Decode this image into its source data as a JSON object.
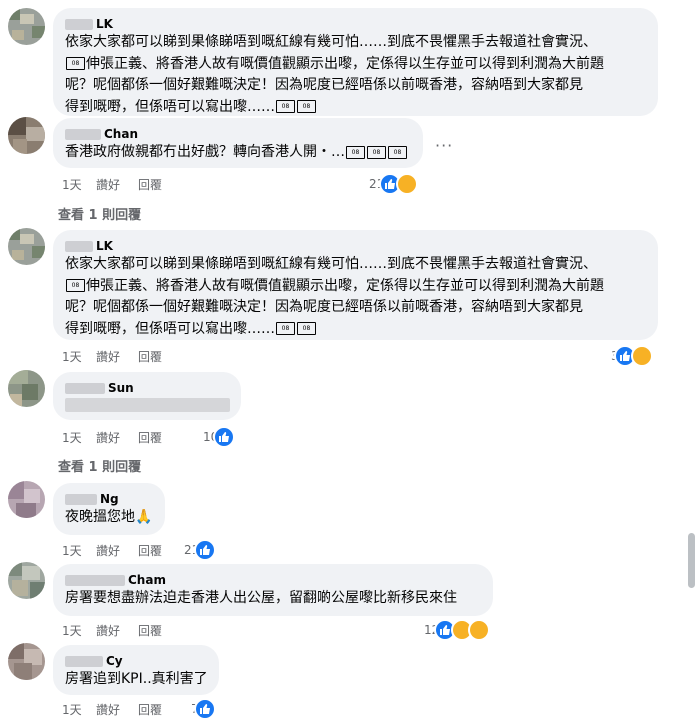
{
  "comments": [
    {
      "name": "LK",
      "text_lines": [
        "依家大家都可以睇到果條睇唔到嘅紅線有幾可怕……到底不畏懼黑手去報道社會實況、",
        "伸張正義、將香港人故有嘅價值觀顯示出嚟，定係得以生存並可以得到利潤為大前題",
        "呢？呢個都係一個好艱難嘅決定！因為呢度已經唔係以前嘅香港，容納唔到大家都見",
        "得到嘅嘢，但係唔可以寫出嚟……"
      ],
      "time": "",
      "like": "",
      "reply": "",
      "count": ""
    },
    {
      "name": "Chan",
      "text": "香港政府做親都冇出好戲？轉向香港人開・…",
      "time": "1天",
      "like": "讚好",
      "reply": "回覆",
      "count": "21"
    },
    {
      "name": "LK",
      "text_lines": [
        "依家大家都可以睇到果條睇唔到嘅紅線有幾可怕……到底不畏懼黑手去報道社會實況、",
        "伸張正義、將香港人故有嘅價值觀顯示出嚟，定係得以生存並可以得到利潤為大前題",
        "呢？呢個都係一個好艱難嘅決定！因為呢度已經唔係以前嘅香港，容納唔到大家都見",
        "得到嘅嘢，但係唔可以寫出嚟……"
      ],
      "time": "1天",
      "like": "讚好",
      "reply": "回覆",
      "count": "3"
    },
    {
      "name": "Sun",
      "text": "",
      "time": "1天",
      "like": "讚好",
      "reply": "回覆",
      "count": "10"
    },
    {
      "name": "Ng",
      "text": "夜晚搵您地🙏",
      "time": "1天",
      "like": "讚好",
      "reply": "回覆",
      "count": "21"
    },
    {
      "name": "Cham",
      "text": "房署要想盡辦法迫走香港人出公屋，留翻啲公屋嚟比新移民來住",
      "time": "1天",
      "like": "讚好",
      "reply": "回覆",
      "count": "12"
    },
    {
      "name": "Cy",
      "text": "房署追到KPI..真利害了",
      "time": "1天",
      "like": "讚好",
      "reply": "回覆",
      "count": "7"
    }
  ],
  "view_replies_1": "查看 1 則回覆",
  "view_replies_2": "查看 1 則回覆",
  "emoji_placeholder": "😭",
  "more_icon": "···",
  "colors": {
    "bubble": "#f0f2f5",
    "like": "#1877f2",
    "meta": "#65676b"
  }
}
